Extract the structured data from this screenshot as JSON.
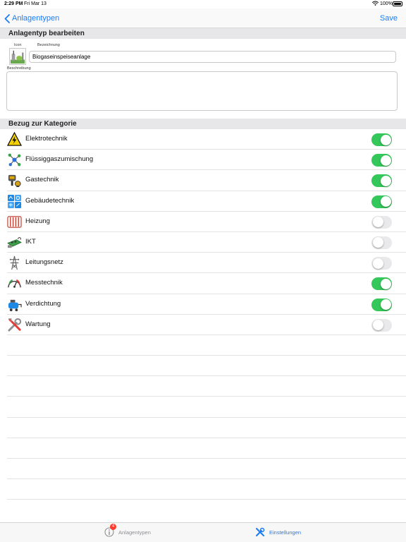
{
  "status_bar": {
    "time": "2:29 PM",
    "date": "Fri Mar 13",
    "battery": "100%"
  },
  "nav": {
    "back_label": "Anlagentypen",
    "save_label": "Save"
  },
  "edit_section": {
    "header": "Anlagentyp bearbeiten",
    "icon_label": "Icon",
    "name_label": "Bezeichnung",
    "name_value": "Biogaseinspeiseanlage",
    "description_label": "Beschreibung",
    "description_value": ""
  },
  "category_section": {
    "header": "Bezug zur Kategorie",
    "items": [
      {
        "label": "Elektrotechnik",
        "icon": "electrical-warning-icon",
        "enabled": true
      },
      {
        "label": "Flüssiggaszumischung",
        "icon": "molecule-icon",
        "enabled": true
      },
      {
        "label": "Gastechnik",
        "icon": "gas-equipment-icon",
        "enabled": true
      },
      {
        "label": "Gebäudetechnik",
        "icon": "building-services-icon",
        "enabled": true
      },
      {
        "label": "Heizung",
        "icon": "radiator-icon",
        "enabled": false
      },
      {
        "label": "IKT",
        "icon": "network-board-icon",
        "enabled": false
      },
      {
        "label": "Leitungsnetz",
        "icon": "power-pylon-icon",
        "enabled": false
      },
      {
        "label": "Messtechnik",
        "icon": "gauge-icon",
        "enabled": true
      },
      {
        "label": "Verdichtung",
        "icon": "compressor-icon",
        "enabled": true
      },
      {
        "label": "Wartung",
        "icon": "tools-icon",
        "enabled": false
      }
    ]
  },
  "tab_bar": {
    "tabs": [
      {
        "label": "Anlagentypen",
        "icon": "info-icon",
        "badge": "4"
      },
      {
        "label": "Einstellungen",
        "icon": "tools-icon",
        "selected": true
      }
    ]
  },
  "colors": {
    "accent": "#1a7cf5",
    "toggle_on": "#34c759",
    "toggle_off": "#e9e9eb",
    "badge": "#ff3b30"
  }
}
